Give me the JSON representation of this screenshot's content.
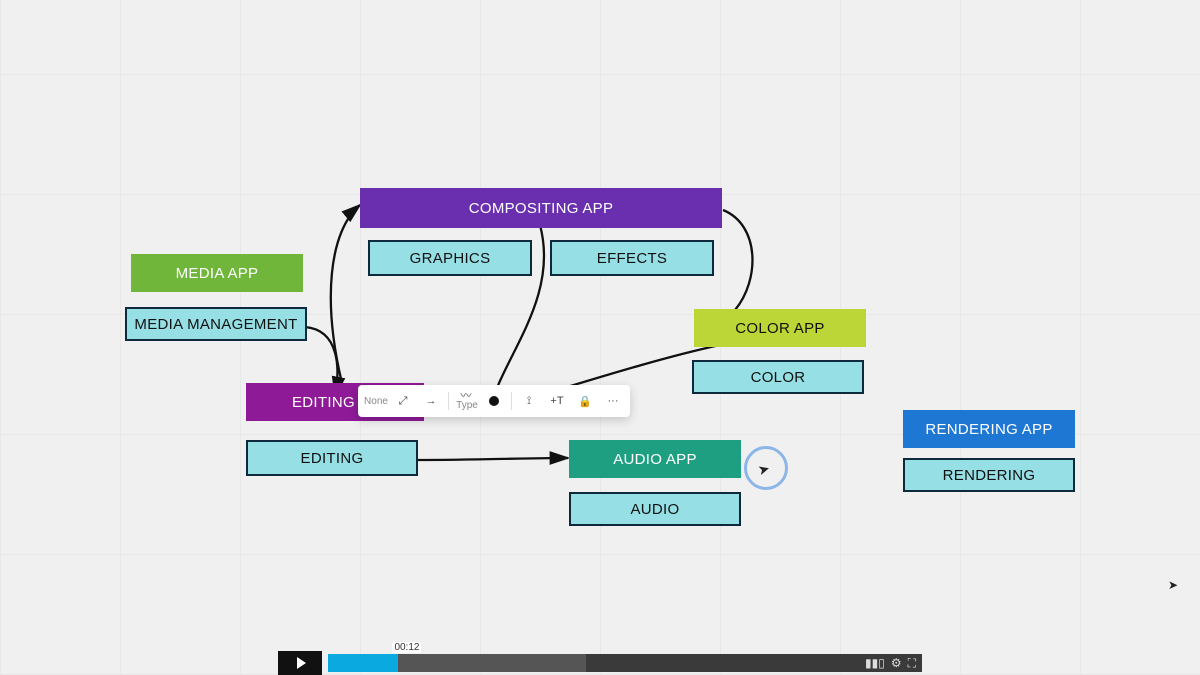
{
  "nodes": {
    "compositing_app": "COMPOSITING APP",
    "graphics": "GRAPHICS",
    "effects": "EFFECTS",
    "media_app": "MEDIA APP",
    "media_management": "MEDIA MANAGEMENT",
    "editing_app": "EDITING APP",
    "editing": "EDITING",
    "color_app": "COLOR APP",
    "color": "COLOR",
    "audio_app": "AUDIO APP",
    "audio": "AUDIO",
    "rendering_app": "RENDERING APP",
    "rendering": "RENDERING"
  },
  "toolbar": {
    "arrow_style": "None",
    "type_label": "Type",
    "text_btn": "+T",
    "more": "···"
  },
  "video": {
    "time": "00:12",
    "played_pct": 13
  }
}
